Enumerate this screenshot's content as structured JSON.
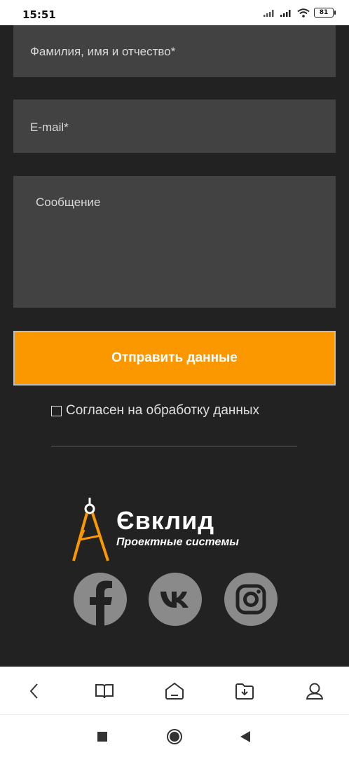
{
  "status_bar": {
    "time": "15:51",
    "battery": "81",
    "icons": [
      "signal-icon",
      "signal-icon",
      "wifi-icon",
      "battery-icon"
    ]
  },
  "form": {
    "name_placeholder": "Фамилия, имя и отчество*",
    "email_placeholder": "E-mail*",
    "message_placeholder": "Сообщение",
    "submit_label": "Отправить данные",
    "consent_label": "Согласен на обработку данных"
  },
  "brand": {
    "name": "Євклид",
    "tagline": "Проектные системы",
    "accent_color": "#fb9800"
  },
  "social": [
    "facebook-icon",
    "vk-icon",
    "instagram-icon"
  ],
  "browser_bar": [
    "back-icon",
    "book-icon",
    "home-icon",
    "download-icon",
    "profile-icon"
  ],
  "system_nav": [
    "recents-icon",
    "home-circle-icon",
    "back-triangle-icon"
  ]
}
